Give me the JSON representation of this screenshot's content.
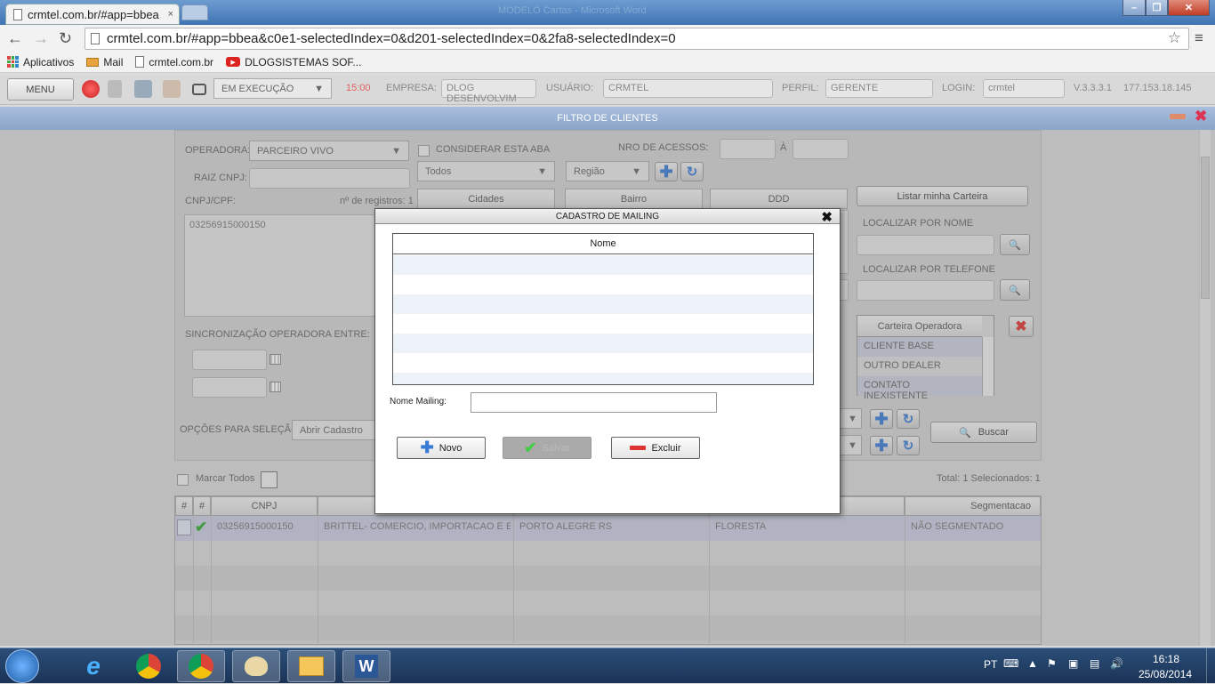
{
  "browser": {
    "tab_title": "crmtel.com.br/#app=bbea",
    "tab_close": "×",
    "window_title": "MODELO Cartas - Microsoft Word",
    "url": "crmtel.com.br/#app=bbea&c0e1-selectedIndex=0&d201-selectedIndex=0&2fa8-selectedIndex=0",
    "bookmarks": [
      "Aplicativos",
      "Mail",
      "crmtel.com.br",
      "DLOGSISTEMAS SOF..."
    ]
  },
  "appbar": {
    "menu_label": "MENU",
    "status": "EM EXECUÇÃO",
    "time": "15:00",
    "empresa_label": "EMPRESA:",
    "empresa_value": "DLOG DESENVOLVIM",
    "usuario_label": "USUÁRIO:",
    "usuario_value": "CRMTEL",
    "perfil_label": "PERFIL:",
    "perfil_value": "GERENTE",
    "login_label": "LOGIN:",
    "login_value": "crmtel",
    "version": "V.3.3.3.1",
    "ip": "177.153.18.145"
  },
  "filter": {
    "header": "FILTRO DE CLIENTES",
    "operadora_label": "OPERADORA:",
    "operadora_value": "PARCEIRO VIVO",
    "considerar_label": "CONSIDERAR ESTA ABA",
    "nro_acessos_label": "NRO DE ACESSOS:",
    "a_label": "À",
    "todos_value": "Todos",
    "regiao_value": "Região",
    "raiz_cnpj_label": "RAIZ CNPJ:",
    "cnpj_cpf_label": "CNPJ/CPF:",
    "nregistros_label": "nº de registros: 1",
    "cnpj_value": "03256915000150",
    "col_cidades": "Cidades",
    "col_bairro": "Bairro",
    "col_ddd": "DDD",
    "listar_button": "Listar minha Carteira",
    "localizar_nome_label": "LOCALIZAR POR NOME",
    "localizar_tel_label": "LOCALIZAR POR TELEFONE",
    "carteira_header": "Carteira Operadora",
    "carteira_items": [
      "CLIENTE BASE",
      "OUTRO DEALER",
      "CONTATO INEXISTENTE"
    ],
    "sincronizacao_label": "SINCRONIZAÇÃO OPERADORA ENTRE:",
    "opcoes_label": "OPÇÕES PARA SELEÇÃO:",
    "opcoes_value": "Abrir Cadastro",
    "buscar_button": "Buscar"
  },
  "grid": {
    "marcar_todos": "Marcar Todos",
    "total": "Total: 1 Selecionados: 1",
    "headers": [
      "#",
      "#",
      "CNPJ",
      "",
      "",
      "",
      "Segmentacao"
    ],
    "row": {
      "cnpj": "03256915000150",
      "razao": "BRITTEL- COMERCIO, IMPORTACAO E EXPORTA",
      "cidade": "PORTO ALEGRE RS",
      "bairro": "FLORESTA",
      "segmentacao": "NÃO SEGMENTADO"
    }
  },
  "modal": {
    "title": "CADASTRO DE MAILING",
    "close": "✖",
    "grid_header": "Nome",
    "nome_mailing_label": "Nome Mailing:",
    "nome_mailing_value": "",
    "novo_button": "Novo",
    "salvar_button": "Salvar",
    "excluir_button": "Excluir"
  },
  "taskbar": {
    "lang": "PT",
    "time": "16:18",
    "date": "25/08/2014"
  },
  "colors": {
    "accent": "#8ba5c9",
    "selected_row": "#c9cbe0",
    "modal_row_alt": "#eef3fa"
  }
}
